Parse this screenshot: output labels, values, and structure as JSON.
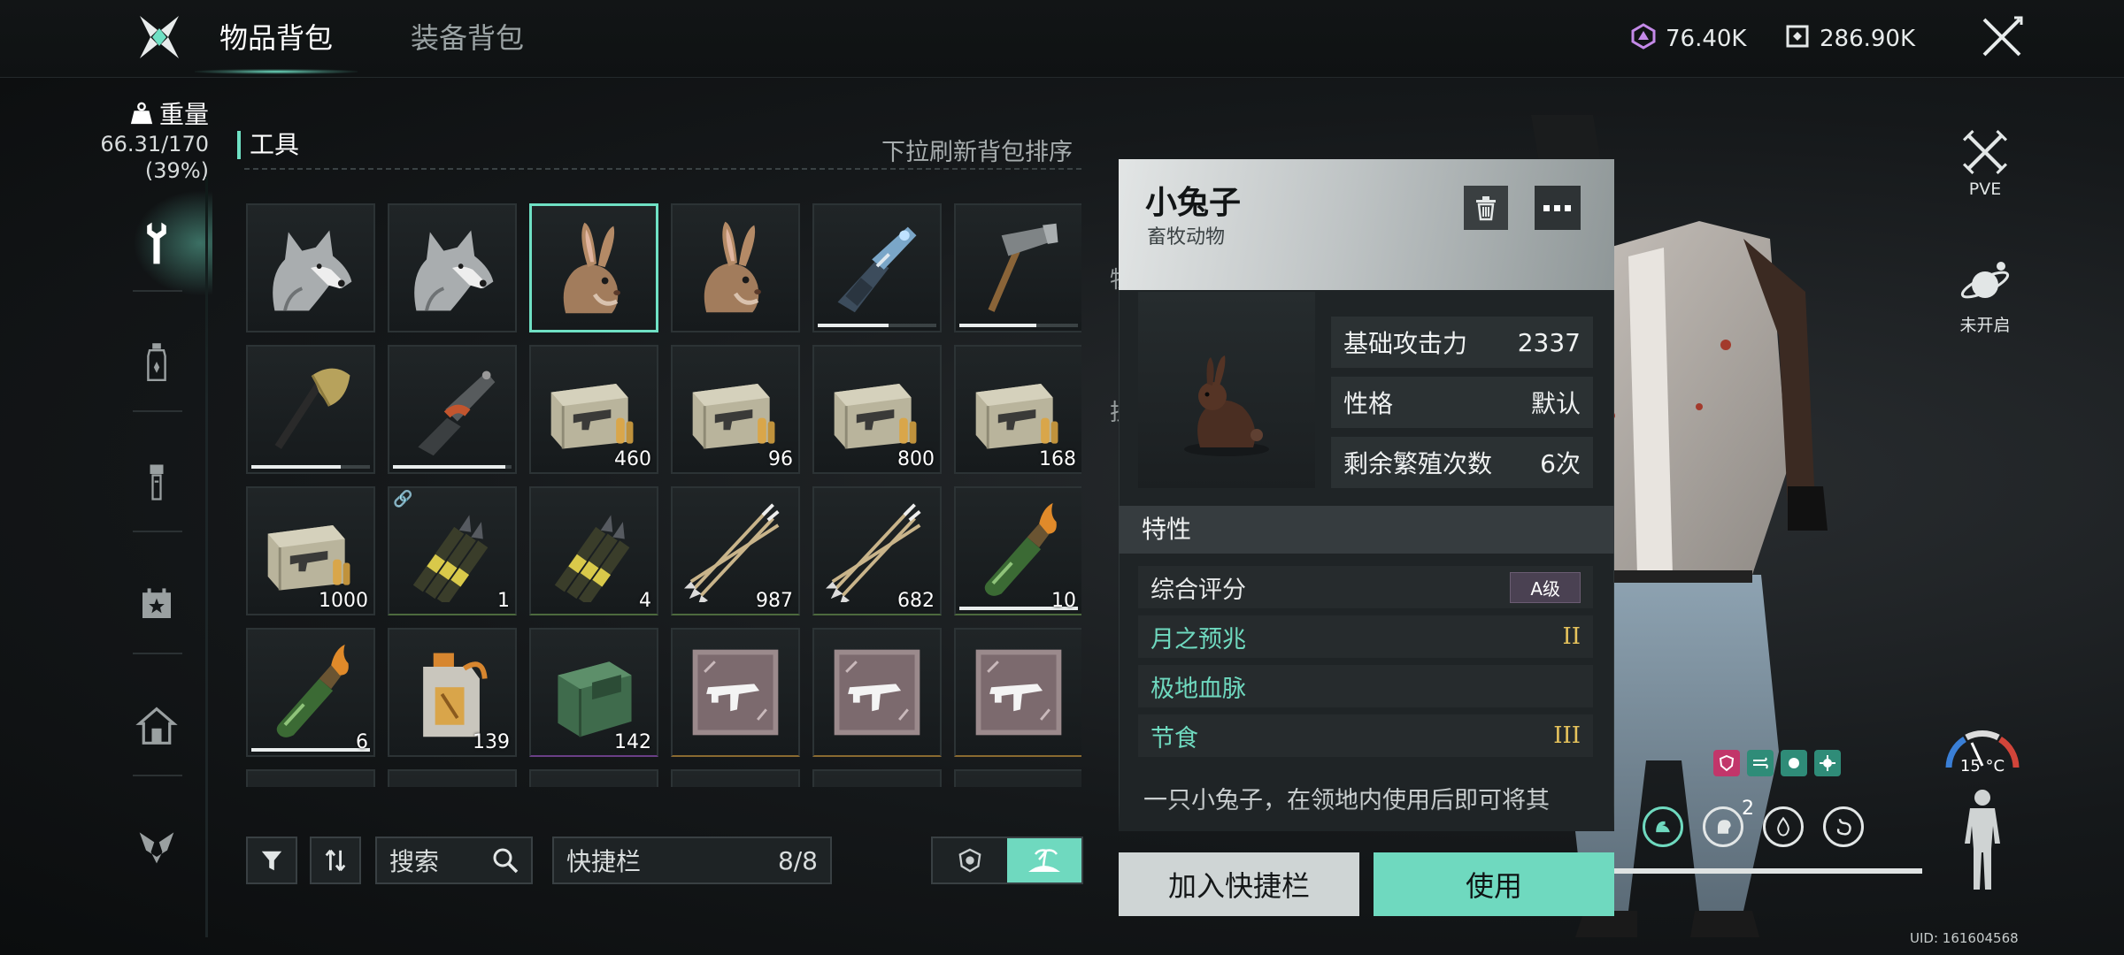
{
  "header": {
    "tabs": [
      {
        "label": "物品背包",
        "active": true
      },
      {
        "label": "装备背包",
        "active": false
      }
    ],
    "currencies": [
      {
        "icon": "crystal-currency-icon",
        "value": "76.40K",
        "color": "#c48ae8"
      },
      {
        "icon": "cube-currency-icon",
        "value": "286.90K",
        "color": "#e4e8e8"
      }
    ],
    "close_icon": "close-x-icon"
  },
  "sidebar": {
    "weight_label": "重量",
    "weight_value": "66.31/170",
    "weight_percent": "(39%)",
    "categories": [
      {
        "icon": "wrench-icon",
        "active": true
      },
      {
        "icon": "bottle-icon",
        "active": false
      },
      {
        "icon": "flashlight-icon",
        "active": false
      },
      {
        "icon": "calendar-star-icon",
        "active": false
      },
      {
        "icon": "home-icon",
        "active": false
      },
      {
        "icon": "emblem-icon",
        "active": false
      }
    ]
  },
  "inventory": {
    "category_title": "工具",
    "sort_hint": "下拉刷新背包排序",
    "items": [
      {
        "icon": "wolf-icon",
        "count": "",
        "durability": null,
        "rarity": "none"
      },
      {
        "icon": "wolf-icon",
        "count": "",
        "durability": null,
        "rarity": "none"
      },
      {
        "icon": "rabbit-icon",
        "count": "",
        "durability": null,
        "rarity": "none",
        "selected": true
      },
      {
        "icon": "rabbit-icon",
        "count": "",
        "durability": null,
        "rarity": "none"
      },
      {
        "icon": "blaster-gun-icon",
        "count": "",
        "durability": 0.6,
        "rarity": "none"
      },
      {
        "icon": "hammer-icon",
        "count": "",
        "durability": 0.65,
        "rarity": "none"
      },
      {
        "icon": "axe-icon",
        "count": "",
        "durability": 0.75,
        "rarity": "none"
      },
      {
        "icon": "chainsaw-icon",
        "count": "",
        "durability": 0.95,
        "rarity": "none"
      },
      {
        "icon": "ammo-box-icon",
        "count": "460",
        "durability": null,
        "rarity": "none"
      },
      {
        "icon": "ammo-box-icon",
        "count": "96",
        "durability": null,
        "rarity": "none"
      },
      {
        "icon": "ammo-box-icon",
        "count": "800",
        "durability": null,
        "rarity": "none"
      },
      {
        "icon": "ammo-box-icon",
        "count": "168",
        "durability": null,
        "rarity": "none"
      },
      {
        "icon": "ammo-box-icon",
        "count": "1000",
        "durability": null,
        "rarity": "none"
      },
      {
        "icon": "rocket-ammo-icon",
        "count": "1",
        "durability": null,
        "rarity": "green",
        "linked": true
      },
      {
        "icon": "rocket-ammo-icon",
        "count": "4",
        "durability": null,
        "rarity": "green"
      },
      {
        "icon": "arrows-icon",
        "count": "987",
        "durability": null,
        "rarity": "green"
      },
      {
        "icon": "arrows-icon",
        "count": "682",
        "durability": null,
        "rarity": "green"
      },
      {
        "icon": "molotov-icon",
        "count": "10",
        "durability": 1.0,
        "rarity": "green"
      },
      {
        "icon": "molotov-icon",
        "count": "6",
        "durability": 1.0,
        "rarity": "none"
      },
      {
        "icon": "fuel-can-icon",
        "count": "139",
        "durability": null,
        "rarity": "none"
      },
      {
        "icon": "ammo-drum-icon",
        "count": "142",
        "durability": null,
        "rarity": "purple"
      },
      {
        "icon": "smg-blueprint-icon",
        "count": "",
        "durability": null,
        "rarity": "gold"
      },
      {
        "icon": "smg-blueprint-icon",
        "count": "",
        "durability": null,
        "rarity": "gold"
      },
      {
        "icon": "smg-blueprint-icon",
        "count": "",
        "durability": null,
        "rarity": "gold"
      }
    ]
  },
  "toolbar": {
    "filter_icon": "filter-icon",
    "sort_icon": "sort-arrows-icon",
    "search_label": "搜索",
    "hotbar_label": "快捷栏",
    "hotbar_count": "8/8",
    "toggle_left_icon": "badge-icon",
    "toggle_right_icon": "island-icon"
  },
  "right_side": {
    "pve_label": "PVE",
    "planet_label": "未开启",
    "temperature": "15 °C",
    "buff_count": "2",
    "uid": "UID: 161604568",
    "effect_icons": [
      "shield-effect-icon",
      "wind-effect-icon",
      "cell-effect-icon",
      "virus-effect-icon"
    ],
    "effect_colors": [
      "#c2366a",
      "#2f8c78",
      "#2f8c78",
      "#2f8c78"
    ],
    "stat_icons": [
      "arm-strength-icon",
      "mind-icon",
      "water-drop-icon",
      "stomach-icon"
    ]
  },
  "popup": {
    "name": "小兔子",
    "type": "畜牧动物",
    "attributes": [
      {
        "label": "基础攻击力",
        "value": "2337"
      },
      {
        "label": "性格",
        "value": "默认"
      },
      {
        "label": "剩余繁殖次数",
        "value": "6次"
      }
    ],
    "traits_title": "特性",
    "overall_label": "综合评分",
    "overall_grade": "A级",
    "traits": [
      {
        "name": "月之预兆",
        "level": "II"
      },
      {
        "name": "极地血脉",
        "level": ""
      },
      {
        "name": "节食",
        "level": "III"
      }
    ],
    "description": "一只小兔子，在领地内使用后即可将其",
    "add_hotbar_label": "加入快捷栏",
    "use_label": "使用"
  }
}
